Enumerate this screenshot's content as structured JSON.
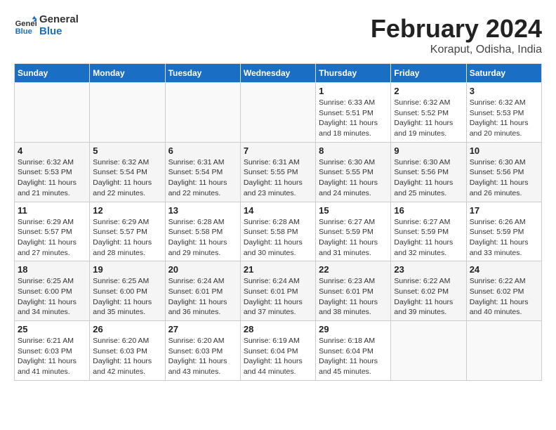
{
  "header": {
    "logo_line1": "General",
    "logo_line2": "Blue",
    "month": "February 2024",
    "location": "Koraput, Odisha, India"
  },
  "days_of_week": [
    "Sunday",
    "Monday",
    "Tuesday",
    "Wednesday",
    "Thursday",
    "Friday",
    "Saturday"
  ],
  "weeks": [
    [
      {
        "day": "",
        "info": ""
      },
      {
        "day": "",
        "info": ""
      },
      {
        "day": "",
        "info": ""
      },
      {
        "day": "",
        "info": ""
      },
      {
        "day": "1",
        "info": "Sunrise: 6:33 AM\nSunset: 5:51 PM\nDaylight: 11 hours and 18 minutes."
      },
      {
        "day": "2",
        "info": "Sunrise: 6:32 AM\nSunset: 5:52 PM\nDaylight: 11 hours and 19 minutes."
      },
      {
        "day": "3",
        "info": "Sunrise: 6:32 AM\nSunset: 5:53 PM\nDaylight: 11 hours and 20 minutes."
      }
    ],
    [
      {
        "day": "4",
        "info": "Sunrise: 6:32 AM\nSunset: 5:53 PM\nDaylight: 11 hours and 21 minutes."
      },
      {
        "day": "5",
        "info": "Sunrise: 6:32 AM\nSunset: 5:54 PM\nDaylight: 11 hours and 22 minutes."
      },
      {
        "day": "6",
        "info": "Sunrise: 6:31 AM\nSunset: 5:54 PM\nDaylight: 11 hours and 22 minutes."
      },
      {
        "day": "7",
        "info": "Sunrise: 6:31 AM\nSunset: 5:55 PM\nDaylight: 11 hours and 23 minutes."
      },
      {
        "day": "8",
        "info": "Sunrise: 6:30 AM\nSunset: 5:55 PM\nDaylight: 11 hours and 24 minutes."
      },
      {
        "day": "9",
        "info": "Sunrise: 6:30 AM\nSunset: 5:56 PM\nDaylight: 11 hours and 25 minutes."
      },
      {
        "day": "10",
        "info": "Sunrise: 6:30 AM\nSunset: 5:56 PM\nDaylight: 11 hours and 26 minutes."
      }
    ],
    [
      {
        "day": "11",
        "info": "Sunrise: 6:29 AM\nSunset: 5:57 PM\nDaylight: 11 hours and 27 minutes."
      },
      {
        "day": "12",
        "info": "Sunrise: 6:29 AM\nSunset: 5:57 PM\nDaylight: 11 hours and 28 minutes."
      },
      {
        "day": "13",
        "info": "Sunrise: 6:28 AM\nSunset: 5:58 PM\nDaylight: 11 hours and 29 minutes."
      },
      {
        "day": "14",
        "info": "Sunrise: 6:28 AM\nSunset: 5:58 PM\nDaylight: 11 hours and 30 minutes."
      },
      {
        "day": "15",
        "info": "Sunrise: 6:27 AM\nSunset: 5:59 PM\nDaylight: 11 hours and 31 minutes."
      },
      {
        "day": "16",
        "info": "Sunrise: 6:27 AM\nSunset: 5:59 PM\nDaylight: 11 hours and 32 minutes."
      },
      {
        "day": "17",
        "info": "Sunrise: 6:26 AM\nSunset: 5:59 PM\nDaylight: 11 hours and 33 minutes."
      }
    ],
    [
      {
        "day": "18",
        "info": "Sunrise: 6:25 AM\nSunset: 6:00 PM\nDaylight: 11 hours and 34 minutes."
      },
      {
        "day": "19",
        "info": "Sunrise: 6:25 AM\nSunset: 6:00 PM\nDaylight: 11 hours and 35 minutes."
      },
      {
        "day": "20",
        "info": "Sunrise: 6:24 AM\nSunset: 6:01 PM\nDaylight: 11 hours and 36 minutes."
      },
      {
        "day": "21",
        "info": "Sunrise: 6:24 AM\nSunset: 6:01 PM\nDaylight: 11 hours and 37 minutes."
      },
      {
        "day": "22",
        "info": "Sunrise: 6:23 AM\nSunset: 6:01 PM\nDaylight: 11 hours and 38 minutes."
      },
      {
        "day": "23",
        "info": "Sunrise: 6:22 AM\nSunset: 6:02 PM\nDaylight: 11 hours and 39 minutes."
      },
      {
        "day": "24",
        "info": "Sunrise: 6:22 AM\nSunset: 6:02 PM\nDaylight: 11 hours and 40 minutes."
      }
    ],
    [
      {
        "day": "25",
        "info": "Sunrise: 6:21 AM\nSunset: 6:03 PM\nDaylight: 11 hours and 41 minutes."
      },
      {
        "day": "26",
        "info": "Sunrise: 6:20 AM\nSunset: 6:03 PM\nDaylight: 11 hours and 42 minutes."
      },
      {
        "day": "27",
        "info": "Sunrise: 6:20 AM\nSunset: 6:03 PM\nDaylight: 11 hours and 43 minutes."
      },
      {
        "day": "28",
        "info": "Sunrise: 6:19 AM\nSunset: 6:04 PM\nDaylight: 11 hours and 44 minutes."
      },
      {
        "day": "29",
        "info": "Sunrise: 6:18 AM\nSunset: 6:04 PM\nDaylight: 11 hours and 45 minutes."
      },
      {
        "day": "",
        "info": ""
      },
      {
        "day": "",
        "info": ""
      }
    ]
  ]
}
